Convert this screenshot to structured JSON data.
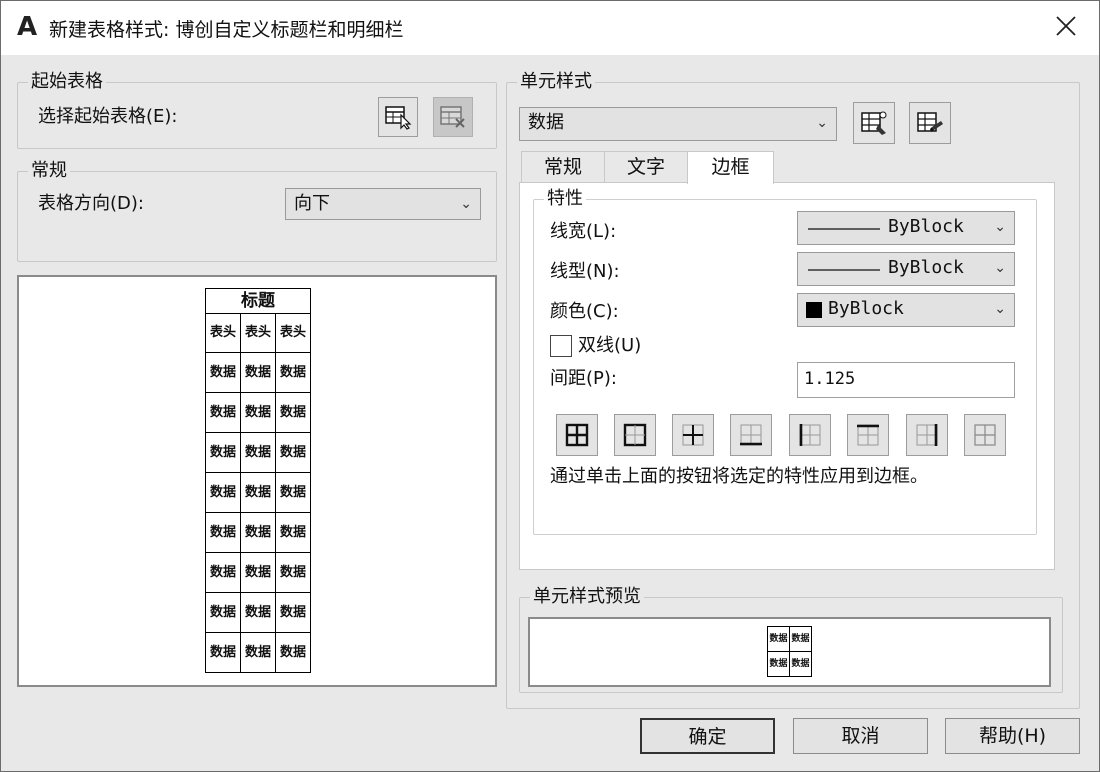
{
  "window": {
    "title": "新建表格样式: 博创自定义标题栏和明细栏",
    "app_icon": "A"
  },
  "start_table": {
    "group_label": "起始表格",
    "select_label": "选择起始表格(E):"
  },
  "general": {
    "group_label": "常规",
    "direction_label": "表格方向(D):",
    "direction_value": "向下"
  },
  "table_preview": {
    "title": "标题",
    "header": [
      "表头",
      "表头",
      "表头"
    ],
    "data_cell": "数据",
    "data_rows": 8
  },
  "cell_style": {
    "group_label": "单元样式",
    "selected": "数据"
  },
  "tabs": [
    {
      "label": "常规",
      "active": false
    },
    {
      "label": "文字",
      "active": false
    },
    {
      "label": "边框",
      "active": true
    }
  ],
  "properties": {
    "group_label": "特性",
    "lineweight_label": "线宽(L):",
    "lineweight_value": "ByBlock",
    "linetype_label": "线型(N):",
    "linetype_value": "ByBlock",
    "color_label": "颜色(C):",
    "color_value": "ByBlock",
    "double_line_label": "双线(U)",
    "double_line_checked": false,
    "spacing_label": "间距(P):",
    "spacing_value": "1.125",
    "hint": "通过单击上面的按钮将选定的特性应用到边框。"
  },
  "border_buttons": [
    "all-borders-icon",
    "outside-borders-icon",
    "inside-borders-icon",
    "bottom-border-icon",
    "left-border-icon",
    "top-border-icon",
    "right-border-icon",
    "no-border-icon"
  ],
  "cell_preview": {
    "group_label": "单元样式预览",
    "cell_text": "数据"
  },
  "buttons": {
    "ok": "确定",
    "cancel": "取消",
    "help": "帮助(H)"
  }
}
